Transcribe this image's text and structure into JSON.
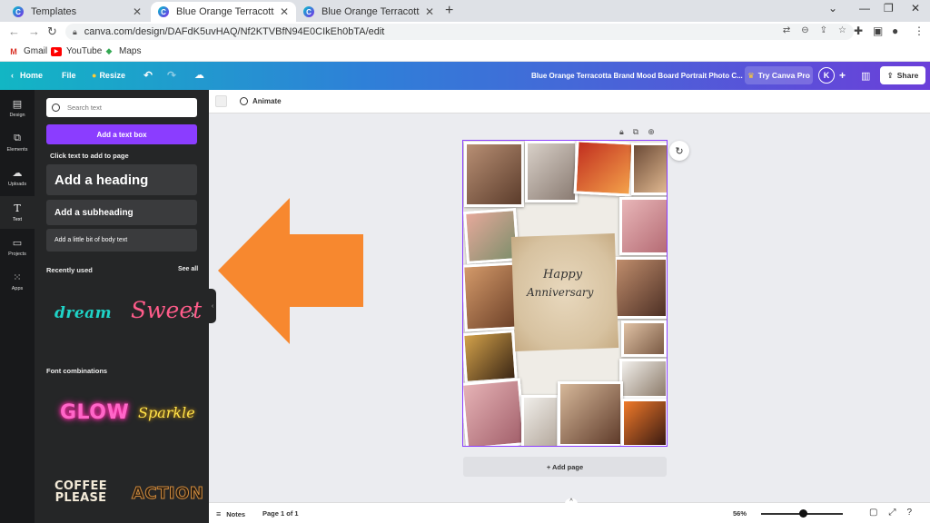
{
  "browser": {
    "tabs": [
      {
        "title": "Templates",
        "active": false
      },
      {
        "title": "Blue Orange Terracotta Brand Mo",
        "active": true
      },
      {
        "title": "Blue Orange Terracotta Brand Mo",
        "active": false
      }
    ],
    "url": "canva.com/design/DAFdK5uvHAQ/Nf2KTVBfN94E0CIkEh0bTA/edit",
    "bookmarks": [
      {
        "label": "Gmail",
        "icon": "gmail-icon"
      },
      {
        "label": "YouTube",
        "icon": "youtube-icon"
      },
      {
        "label": "Maps",
        "icon": "maps-icon"
      }
    ]
  },
  "header": {
    "home": "Home",
    "file": "File",
    "resize": "Resize",
    "doc_title": "Blue Orange Terracotta Brand Mood Board Portrait Photo C...",
    "try_pro": "Try Canva Pro",
    "avatar": "K",
    "share": "Share"
  },
  "rail": [
    {
      "label": "Design",
      "icon": "design-icon",
      "active": false
    },
    {
      "label": "Elements",
      "icon": "elements-icon",
      "active": false
    },
    {
      "label": "Uploads",
      "icon": "uploads-icon",
      "active": false
    },
    {
      "label": "Text",
      "icon": "text-icon",
      "active": true
    },
    {
      "label": "Projects",
      "icon": "projects-icon",
      "active": false
    },
    {
      "label": "Apps",
      "icon": "apps-icon",
      "active": false
    }
  ],
  "panel": {
    "search_placeholder": "Search text",
    "add_text_box": "Add a text box",
    "click_to_add": "Click text to add to page",
    "heading": "Add a heading",
    "subheading": "Add a subheading",
    "body": "Add a little bit of body text",
    "recently_used": "Recently used",
    "see_all": "See all",
    "recent_styles": [
      "dream",
      "Sweet"
    ],
    "font_combinations": "Font combinations",
    "combos": [
      "GLOW",
      "Sparkle",
      "COFFEE",
      "PLEASE",
      "ACTION"
    ]
  },
  "editor": {
    "animate": "Animate",
    "design_text_1": "Happy",
    "design_text_2": "Anniversary",
    "add_page": "+ Add page",
    "notes": "Notes",
    "page_info": "Page 1 of 1",
    "zoom": "56%",
    "zoom_level": 0.56
  },
  "colors": {
    "accent_purple": "#8b3dff",
    "header_start": "#12b6c4",
    "header_end": "#6b3fd9",
    "panel_bg": "#252627",
    "annotation_arrow": "#f7882f"
  }
}
